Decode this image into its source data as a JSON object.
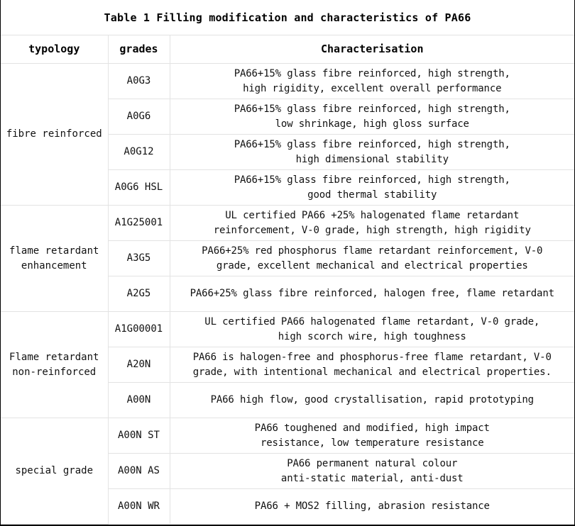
{
  "title": "Table 1 Filling modification and characteristics of PA66",
  "headers": {
    "typology": "typology",
    "grades": "grades",
    "characterisation": "Characterisation"
  },
  "groups": [
    {
      "typology": [
        "fibre reinforced"
      ],
      "rows": [
        {
          "grade": "A0G3",
          "desc": [
            "PA66+15% glass fibre reinforced, high strength,",
            "high rigidity, excellent overall performance"
          ]
        },
        {
          "grade": "A0G6",
          "desc": [
            "PA66+15% glass fibre reinforced, high strength,",
            "low shrinkage, high gloss surface"
          ]
        },
        {
          "grade": "A0G12",
          "desc": [
            "PA66+15% glass fibre reinforced, high strength,",
            "high dimensional stability"
          ]
        },
        {
          "grade": "A0G6 HSL",
          "desc": [
            "PA66+15% glass fibre reinforced, high strength,",
            "good thermal stability"
          ]
        }
      ]
    },
    {
      "typology": [
        "flame retardant",
        "enhancement"
      ],
      "rows": [
        {
          "grade": "A1G25001",
          "desc": [
            "UL certified PA66 +25% halogenated flame retardant",
            "reinforcement, V-0 grade, high strength, high rigidity"
          ]
        },
        {
          "grade": "A3G5",
          "desc": [
            "PA66+25% red phosphorus flame retardant reinforcement, V-0",
            "grade, excellent mechanical and electrical properties"
          ]
        },
        {
          "grade": "A2G5",
          "desc": [
            "PA66+25% glass fibre reinforced, halogen free, flame retardant"
          ]
        }
      ]
    },
    {
      "typology": [
        "Flame retardant",
        "non-reinforced"
      ],
      "rows": [
        {
          "grade": "A1G00001",
          "desc": [
            "UL certified PA66 halogenated flame retardant, V-0 grade,",
            "high scorch wire, high toughness"
          ]
        },
        {
          "grade": "A20N",
          "desc": [
            "PA66 is halogen-free and phosphorus-free flame retardant, V-0",
            "grade, with intentional mechanical and electrical properties."
          ]
        },
        {
          "grade": "A00N",
          "desc": [
            "PA66 high flow, good crystallisation, rapid prototyping"
          ]
        }
      ]
    },
    {
      "typology": [
        "special grade"
      ],
      "rows": [
        {
          "grade": "A00N ST",
          "desc": [
            "PA66 toughened and modified, high impact",
            "resistance, low temperature resistance"
          ]
        },
        {
          "grade": "A00N AS",
          "desc": [
            "PA66 permanent natural colour",
            "anti-static material, anti-dust"
          ]
        },
        {
          "grade": "A00N WR",
          "desc": [
            "PA66 + MOS2 filling, abrasion resistance"
          ]
        }
      ]
    }
  ]
}
